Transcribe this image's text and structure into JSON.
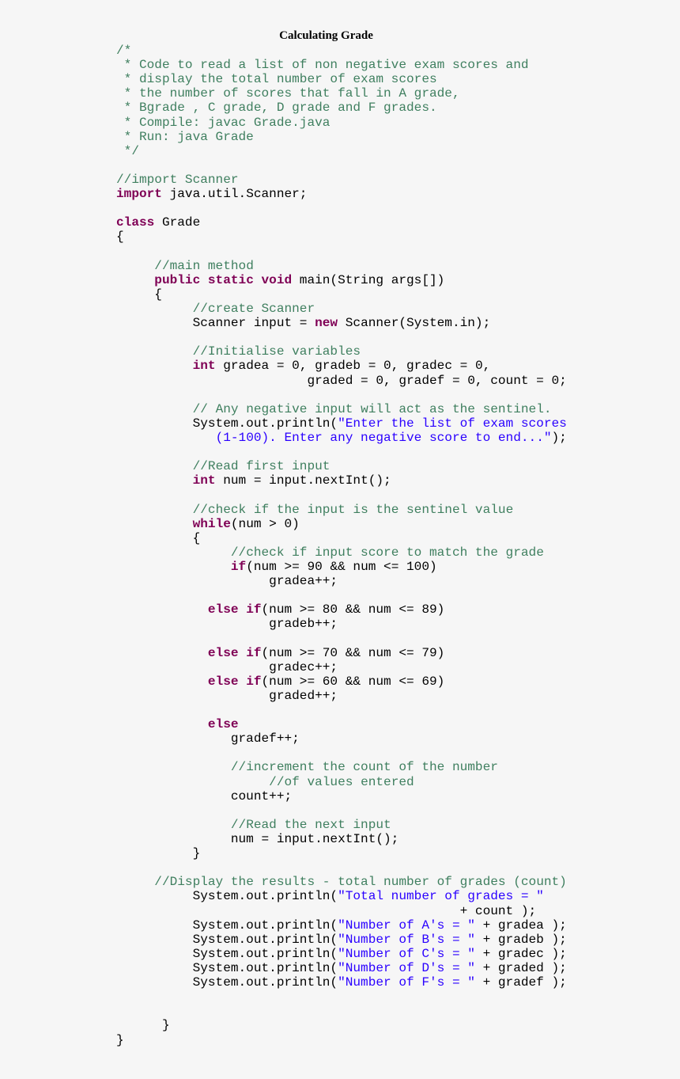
{
  "title": "Calculating Grade",
  "colors": {
    "keyword": "#7f0055",
    "comment": "#3f7f5f",
    "string": "#2a00ff",
    "plain": "#000000",
    "background": "#f6f6f6"
  },
  "code_lines": [
    [
      {
        "t": "cm",
        "v": "/*"
      }
    ],
    [
      {
        "t": "cm",
        "v": " * Code to read a list of non negative exam scores and"
      }
    ],
    [
      {
        "t": "cm",
        "v": " * display the total number of exam scores"
      }
    ],
    [
      {
        "t": "cm",
        "v": " * the number of scores that fall in A grade,"
      }
    ],
    [
      {
        "t": "cm",
        "v": " * Bgrade , C grade, D grade and F grades."
      }
    ],
    [
      {
        "t": "cm",
        "v": " * Compile: javac Grade.java"
      }
    ],
    [
      {
        "t": "cm",
        "v": " * Run: java Grade"
      }
    ],
    [
      {
        "t": "cm",
        "v": " */"
      }
    ],
    [],
    [
      {
        "t": "cm",
        "v": "//import Scanner"
      }
    ],
    [
      {
        "t": "kw",
        "v": "import"
      },
      {
        "t": "p",
        "v": " java.util.Scanner;"
      }
    ],
    [],
    [
      {
        "t": "kw",
        "v": "class"
      },
      {
        "t": "p",
        "v": " Grade"
      }
    ],
    [
      {
        "t": "p",
        "v": "{"
      }
    ],
    [],
    [
      {
        "t": "p",
        "v": "     "
      },
      {
        "t": "cm",
        "v": "//main method"
      }
    ],
    [
      {
        "t": "p",
        "v": "     "
      },
      {
        "t": "kw",
        "v": "public static void"
      },
      {
        "t": "p",
        "v": " main(String args[])"
      }
    ],
    [
      {
        "t": "p",
        "v": "     {"
      }
    ],
    [
      {
        "t": "p",
        "v": "          "
      },
      {
        "t": "cm",
        "v": "//create Scanner"
      }
    ],
    [
      {
        "t": "p",
        "v": "          Scanner input = "
      },
      {
        "t": "kw",
        "v": "new"
      },
      {
        "t": "p",
        "v": " Scanner(System.in);"
      }
    ],
    [],
    [
      {
        "t": "p",
        "v": "          "
      },
      {
        "t": "cm",
        "v": "//Initialise variables"
      }
    ],
    [
      {
        "t": "p",
        "v": "          "
      },
      {
        "t": "kw",
        "v": "int"
      },
      {
        "t": "p",
        "v": " gradea = 0, gradeb = 0, gradec = 0,"
      }
    ],
    [
      {
        "t": "p",
        "v": "                         graded = 0, gradef = 0, count = 0;"
      }
    ],
    [],
    [
      {
        "t": "p",
        "v": "          "
      },
      {
        "t": "cm",
        "v": "// Any negative input will act as the sentinel."
      }
    ],
    [
      {
        "t": "p",
        "v": "          System.out.println("
      },
      {
        "t": "str",
        "v": "\"Enter the list of exam scores"
      }
    ],
    [
      {
        "t": "p",
        "v": "             "
      },
      {
        "t": "str",
        "v": "(1-100). Enter any negative score to end...\""
      },
      {
        "t": "p",
        "v": ");"
      }
    ],
    [],
    [
      {
        "t": "p",
        "v": "          "
      },
      {
        "t": "cm",
        "v": "//Read first input"
      }
    ],
    [
      {
        "t": "p",
        "v": "          "
      },
      {
        "t": "kw",
        "v": "int"
      },
      {
        "t": "p",
        "v": " num = input.nextInt();"
      }
    ],
    [],
    [
      {
        "t": "p",
        "v": "          "
      },
      {
        "t": "cm",
        "v": "//check if the input is the sentinel value"
      }
    ],
    [
      {
        "t": "p",
        "v": "          "
      },
      {
        "t": "kw",
        "v": "while"
      },
      {
        "t": "p",
        "v": "(num > 0)"
      }
    ],
    [
      {
        "t": "p",
        "v": "          {"
      }
    ],
    [
      {
        "t": "p",
        "v": "               "
      },
      {
        "t": "cm",
        "v": "//check if input score to match the grade"
      }
    ],
    [
      {
        "t": "p",
        "v": "               "
      },
      {
        "t": "kw",
        "v": "if"
      },
      {
        "t": "p",
        "v": "(num >= 90 && num <= 100)"
      }
    ],
    [
      {
        "t": "p",
        "v": "                    gradea++;"
      }
    ],
    [],
    [
      {
        "t": "p",
        "v": "            "
      },
      {
        "t": "kw",
        "v": "else if"
      },
      {
        "t": "p",
        "v": "(num >= 80 && num <= 89)"
      }
    ],
    [
      {
        "t": "p",
        "v": "                    gradeb++;"
      }
    ],
    [],
    [
      {
        "t": "p",
        "v": "            "
      },
      {
        "t": "kw",
        "v": "else if"
      },
      {
        "t": "p",
        "v": "(num >= 70 && num <= 79)"
      }
    ],
    [
      {
        "t": "p",
        "v": "                    gradec++;"
      }
    ],
    [
      {
        "t": "p",
        "v": "            "
      },
      {
        "t": "kw",
        "v": "else if"
      },
      {
        "t": "p",
        "v": "(num >= 60 && num <= 69)"
      }
    ],
    [
      {
        "t": "p",
        "v": "                    graded++;"
      }
    ],
    [],
    [
      {
        "t": "p",
        "v": "            "
      },
      {
        "t": "kw",
        "v": "else"
      }
    ],
    [
      {
        "t": "p",
        "v": "               gradef++;"
      }
    ],
    [],
    [
      {
        "t": "p",
        "v": "               "
      },
      {
        "t": "cm",
        "v": "//increment the count of the number"
      }
    ],
    [
      {
        "t": "p",
        "v": "                    "
      },
      {
        "t": "cm",
        "v": "//of values entered"
      }
    ],
    [
      {
        "t": "p",
        "v": "               count++;"
      }
    ],
    [],
    [
      {
        "t": "p",
        "v": "               "
      },
      {
        "t": "cm",
        "v": "//Read the next input"
      }
    ],
    [
      {
        "t": "p",
        "v": "               num = input.nextInt();"
      }
    ],
    [
      {
        "t": "p",
        "v": "          }"
      }
    ],
    [],
    [
      {
        "t": "p",
        "v": "     "
      },
      {
        "t": "cm",
        "v": "//Display the results - total number of grades (count)"
      }
    ],
    [
      {
        "t": "p",
        "v": "          System.out.println("
      },
      {
        "t": "str",
        "v": "\"Total number of grades = \""
      }
    ],
    [
      {
        "t": "p",
        "v": "                                             + count );"
      }
    ],
    [
      {
        "t": "p",
        "v": "          System.out.println("
      },
      {
        "t": "str",
        "v": "\"Number of A's = \""
      },
      {
        "t": "p",
        "v": " + gradea );"
      }
    ],
    [
      {
        "t": "p",
        "v": "          System.out.println("
      },
      {
        "t": "str",
        "v": "\"Number of B's = \""
      },
      {
        "t": "p",
        "v": " + gradeb );"
      }
    ],
    [
      {
        "t": "p",
        "v": "          System.out.println("
      },
      {
        "t": "str",
        "v": "\"Number of C's = \""
      },
      {
        "t": "p",
        "v": " + gradec );"
      }
    ],
    [
      {
        "t": "p",
        "v": "          System.out.println("
      },
      {
        "t": "str",
        "v": "\"Number of D's = \""
      },
      {
        "t": "p",
        "v": " + graded );"
      }
    ],
    [
      {
        "t": "p",
        "v": "          System.out.println("
      },
      {
        "t": "str",
        "v": "\"Number of F's = \""
      },
      {
        "t": "p",
        "v": " + gradef );"
      }
    ],
    [],
    [],
    [
      {
        "t": "p",
        "v": "      }"
      }
    ],
    [
      {
        "t": "p",
        "v": "}"
      }
    ]
  ]
}
